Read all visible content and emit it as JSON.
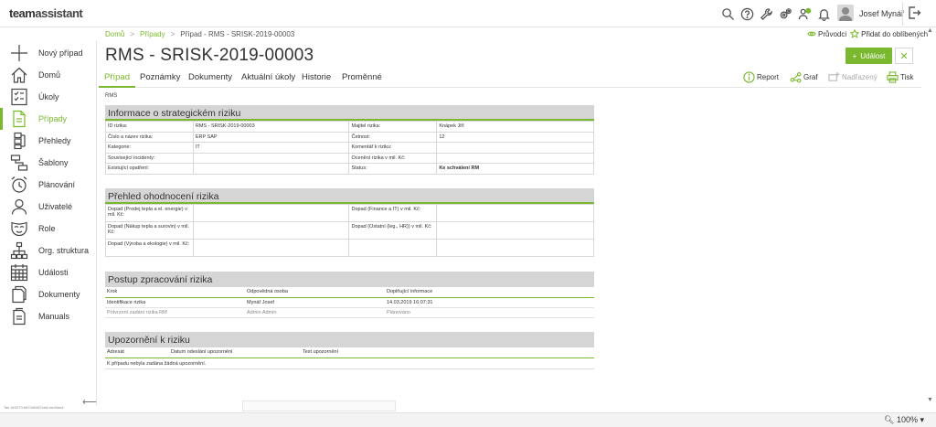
{
  "app": {
    "logo_team": "team",
    "logo_assist": "assistant"
  },
  "header": {
    "user_name": "Josef Mynář"
  },
  "sidebar": {
    "items": [
      {
        "label": "Nový případ",
        "icon": "plus-icon"
      },
      {
        "label": "Domů",
        "icon": "home-icon"
      },
      {
        "label": "Úkoly",
        "icon": "tasks-icon"
      },
      {
        "label": "Případy",
        "icon": "cases-icon",
        "active": true
      },
      {
        "label": "Přehledy",
        "icon": "overview-icon"
      },
      {
        "label": "Šablony",
        "icon": "templates-icon"
      },
      {
        "label": "Plánování",
        "icon": "alarm-clock-icon"
      },
      {
        "label": "Uživatelé",
        "icon": "user-icon"
      },
      {
        "label": "Role",
        "icon": "mask-icon"
      },
      {
        "label": "Org. struktura",
        "icon": "org-structure-icon"
      },
      {
        "label": "Události",
        "icon": "calendar-icon"
      },
      {
        "label": "Dokumenty",
        "icon": "documents-icon"
      },
      {
        "label": "Manuals",
        "icon": "manuals-icon"
      }
    ],
    "build_info": "Tas 3#3270:b874d0487ced tas4/tas4"
  },
  "breadcrumb": {
    "home": "Domů",
    "sep": ">",
    "cases": "Případy",
    "current": "Případ - RMS - SRISK-2019-00003"
  },
  "top_actions": {
    "guide": "Průvodci",
    "favorite": "Přidat do oblíbených"
  },
  "page": {
    "title": "RMS - SRISK-2019-00003",
    "event_button": "Událost",
    "section_label": "RMS"
  },
  "tabs": [
    "Případ",
    "Poznámky",
    "Dokumenty",
    "Aktuální úkoly",
    "Historie",
    "Proměnné"
  ],
  "tools": {
    "report": "Report",
    "graph": "Graf",
    "parent": "Nadřazený",
    "print": "Tisk"
  },
  "section1": {
    "title": "Informace o strategickém riziku",
    "rows": [
      [
        "ID rizika:",
        "RMS - SRISK-2019-00003",
        "Majitel rizika:",
        "Knápek Jiří"
      ],
      [
        "Číslo a název rizika:",
        "ERP SAP",
        "Četnost:",
        "12"
      ],
      [
        "Kategorie:",
        "IT",
        "Komentář k riziku:",
        ""
      ],
      [
        "Související incidenty:",
        "",
        "Ocenění rizika v mil. Kč:",
        ""
      ],
      [
        "Existující opatření:",
        "",
        "Status:",
        "Ke schválení RM"
      ]
    ]
  },
  "section2": {
    "title": "Přehled ohodnocení rizika",
    "rows": [
      [
        "Dopad (Prodej tepla a el. energie) v mil. Kč:",
        "",
        "Dopad (Finance a IT) v mil. Kč:",
        ""
      ],
      [
        "Dopad (Nákup tepla a surovin) v mil. Kč:",
        "",
        "Dopad (Ostatní (leg., HR)) v mil. Kč:",
        ""
      ],
      [
        "Dopad (Výroba a ekologie) v mil. Kč:",
        "",
        "",
        ""
      ]
    ]
  },
  "section3": {
    "title": "Postup zpracování rizika",
    "headers": [
      "Krok",
      "Odpovědná osoba",
      "Doplňující informace"
    ],
    "rows": [
      [
        "Identifikace rizika",
        "Mynář Josef",
        "14.03.2019 16:07:31"
      ],
      [
        "Potvrzení zadání rizika RM",
        "Admin Admin",
        "Plánováno"
      ]
    ]
  },
  "section4": {
    "title": "Upozornění k riziku",
    "headers": [
      "Adresát",
      "Datum odeslání upozornění",
      "Text upozornění"
    ],
    "empty": "K případu nebyla zadána žádná upozornění."
  },
  "statusbar": {
    "zoom": "100%"
  }
}
